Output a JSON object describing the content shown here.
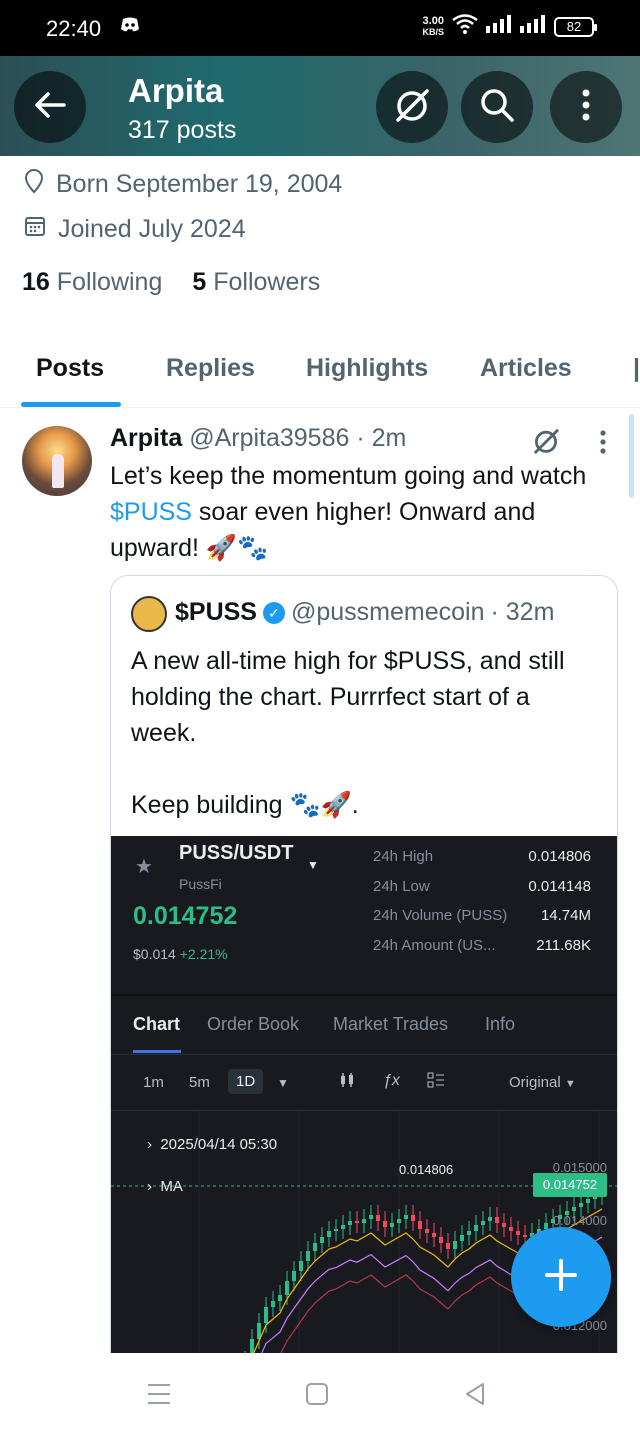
{
  "status_bar": {
    "time": "22:40",
    "net_speed_value": "3.00",
    "net_speed_unit": "KB/S",
    "battery": "82"
  },
  "profile": {
    "name": "Arpita",
    "post_count": "317 posts",
    "born": "Born September 19, 2004",
    "joined": "Joined July 2024",
    "following_count": "16",
    "following_label": "Following",
    "followers_count": "5",
    "followers_label": "Followers"
  },
  "tabs": [
    {
      "label": "Posts",
      "active": true
    },
    {
      "label": "Replies"
    },
    {
      "label": "Highlights"
    },
    {
      "label": "Articles"
    }
  ],
  "post": {
    "author_name": "Arpita",
    "author_handle": "@Arpita39586",
    "time": "· 2m",
    "text_before": "Let’s keep the momentum going and watch ",
    "cashtag": "$PUSS",
    "text_after": " soar even higher! Onward and upward! 🚀🐾"
  },
  "quote": {
    "author_name": "$PUSS",
    "author_handle": "@pussmemecoin",
    "time": "· 32m",
    "text_line1": "A new all-time high for $PUSS, and still holding the chart. Purrrfect start of a week.",
    "text_line2": "Keep building 🐾🚀."
  },
  "trade_card": {
    "pair": "PUSS/USDT",
    "project": "PussFi",
    "last_price": "0.014752",
    "fiat": "$0.014",
    "change": "+2.21%",
    "stats": [
      {
        "label": "24h High",
        "value": "0.014806"
      },
      {
        "label": "24h Low",
        "value": "0.014148"
      },
      {
        "label": "24h Volume (PUSS)",
        "value": "14.74M"
      },
      {
        "label": "24h Amount (US...",
        "value": "211.68K"
      }
    ],
    "tabs": [
      "Chart",
      "Order Book",
      "Market Trades",
      "Info"
    ],
    "timeframes": [
      "1m",
      "5m",
      "1D"
    ],
    "selected_timeframe": "1D",
    "price_type": "Original",
    "chart_date": "2025/04/14 05:30",
    "ma_label": "MA",
    "high_marker": "0.014806",
    "axis_labels": [
      "0.015000",
      "0.014000",
      "0.012000"
    ],
    "current_price_tag": "0.014752",
    "colors": {
      "up": "#2ebd85",
      "down": "#f6465d",
      "bg": "#181a20"
    }
  },
  "icons": [
    "back-arrow-icon",
    "grok-icon",
    "search-icon",
    "more-vertical-icon",
    "location-pin-icon",
    "calendar-icon",
    "compose-plus-icon"
  ]
}
